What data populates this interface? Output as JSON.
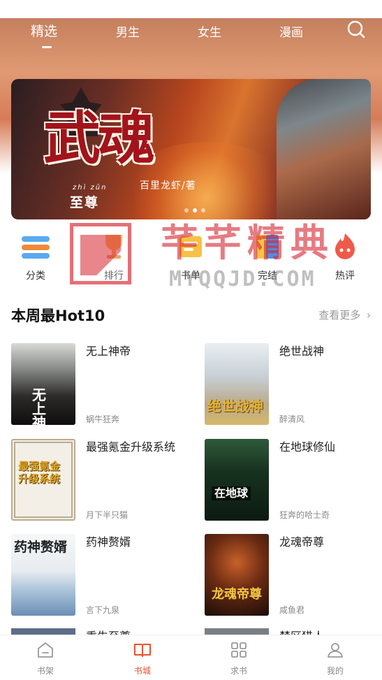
{
  "top_tabs": {
    "items": [
      "精选",
      "男生",
      "女生",
      "漫画"
    ],
    "active_index": 0
  },
  "banner": {
    "title": "武魂",
    "pinyin": "zhì zūn",
    "subtitle": "至尊",
    "author": "百里龙虾/著",
    "dots": 3,
    "active_dot": 1
  },
  "categories": [
    {
      "label": "分类",
      "icon": "category-icon"
    },
    {
      "label": "排行",
      "icon": "trophy-icon"
    },
    {
      "label": "书单",
      "icon": "booklist-icon"
    },
    {
      "label": "完结",
      "icon": "completed-icon"
    },
    {
      "label": "热评",
      "icon": "hot-comment-icon"
    }
  ],
  "watermark": {
    "text": "芊芊精典",
    "url": "MYQQJD.COM"
  },
  "hot_section": {
    "title": "本周最Hot10",
    "more": "查看更多",
    "books": [
      {
        "title": "无上神帝",
        "author": "蜗牛狂奔",
        "cover_text": "无上神帝"
      },
      {
        "title": "绝世战神",
        "author": "醉清风",
        "cover_text": "绝世战神"
      },
      {
        "title": "最强氪金升级系统",
        "author": "月下半只猫",
        "cover_text": "最强氪金升级系统"
      },
      {
        "title": "在地球修仙",
        "author": "狂奔的哈士奇",
        "cover_text": "在地球"
      },
      {
        "title": "药神赘婿",
        "author": "言下九泉",
        "cover_text": "药神赘婿"
      },
      {
        "title": "龙魂帝尊",
        "author": "咸鱼君",
        "cover_text": "龙魂帝尊"
      }
    ],
    "peek_titles": [
      "重生至尊",
      "禁区猎人"
    ]
  },
  "bottom_nav": {
    "items": [
      {
        "label": "书架",
        "icon": "bookshelf-icon"
      },
      {
        "label": "书城",
        "icon": "bookstore-icon"
      },
      {
        "label": "求书",
        "icon": "request-book-icon"
      },
      {
        "label": "我的",
        "icon": "profile-icon"
      }
    ],
    "active_index": 1
  },
  "colors": {
    "accent": "#e8532f",
    "banner_title": "#a3131b",
    "watermark_red": "#d5232d"
  }
}
